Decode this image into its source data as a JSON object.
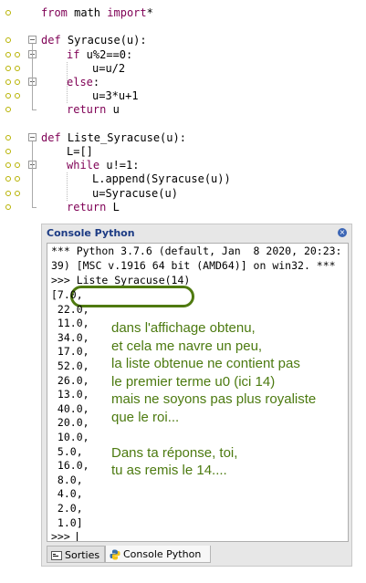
{
  "editor": {
    "lines": [
      {
        "indent": 0,
        "kw": "from",
        "rest": " math ",
        "kw2": "import",
        "rest2": "*"
      },
      {
        "indent": 0,
        "kw": "",
        "rest": ""
      },
      {
        "indent": 0,
        "kw": "def",
        "rest": " Syracuse(u):"
      },
      {
        "indent": 1,
        "kw": "if",
        "rest": " u%2==0:"
      },
      {
        "indent": 2,
        "kw": "",
        "rest": "u=u/2"
      },
      {
        "indent": 1,
        "kw": "else",
        "rest": ":"
      },
      {
        "indent": 2,
        "kw": "",
        "rest": "u=3*u+1"
      },
      {
        "indent": 1,
        "kw": "return",
        "rest": " u"
      },
      {
        "indent": 0,
        "kw": "",
        "rest": ""
      },
      {
        "indent": 0,
        "kw": "def",
        "rest": " Liste_Syracuse(u):"
      },
      {
        "indent": 1,
        "kw": "",
        "rest": "L=[]"
      },
      {
        "indent": 1,
        "kw": "while",
        "rest": " u!=1:"
      },
      {
        "indent": 2,
        "kw": "",
        "rest": "L.append(Syracuse(u))"
      },
      {
        "indent": 2,
        "kw": "",
        "rest": "u=Syracuse(u)"
      },
      {
        "indent": 1,
        "kw": "return",
        "rest": " L"
      }
    ]
  },
  "console": {
    "title": "Console Python",
    "banner1": "*** Python 3.7.6 (default, Jan  8 2020, 20:23:",
    "banner2": "39) [MSC v.1916 64 bit (AMD64)] on win32. ***",
    "prompt_command": ">>> Liste_Syracuse(14)",
    "results": [
      "[7.0,",
      " 22.0,",
      " 11.0,",
      " 34.0,",
      " 17.0,",
      " 52.0,",
      " 26.0,",
      " 13.0,",
      " 40.0,",
      " 20.0,",
      " 10.0,",
      " 5.0,",
      " 16.0,",
      " 8.0,",
      " 4.0,",
      " 2.0,",
      " 1.0]"
    ],
    "final_prompt": ">>> ",
    "annotation": [
      "dans l'affichage obtenu,",
      "et cela me navre un peu,",
      "la liste obtenue ne contient pas",
      "le premier terme u0 (ici 14)",
      "mais ne soyons pas plus royaliste",
      "que le roi...",
      "",
      "Dans ta réponse, toi,",
      "tu as remis le 14...."
    ],
    "tabs": [
      {
        "label": "Sorties",
        "icon": "output-icon"
      },
      {
        "label": "Console Python",
        "icon": "python-icon"
      }
    ]
  },
  "colors": {
    "keyword": "#7f0055",
    "annotation": "#4c7a10",
    "console_title": "#1c3b84"
  }
}
